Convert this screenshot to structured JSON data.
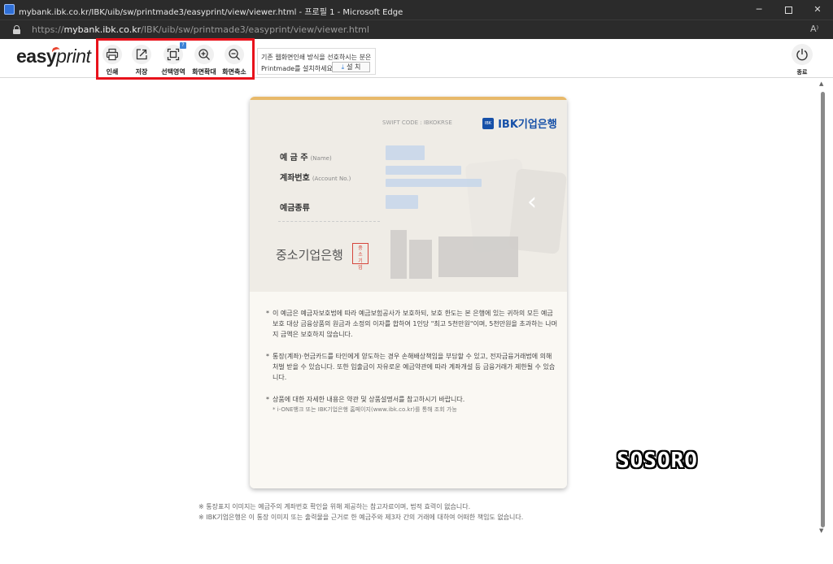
{
  "window": {
    "title": "mybank.ibk.co.kr/IBK/uib/sw/printmade3/easyprint/view/viewer.html - 프로필 1 - Microsoft Edge",
    "minimize": "─",
    "close": "✕"
  },
  "address": {
    "scheme": "https://",
    "host": "mybank.ibk.co.kr",
    "path": "/IBK/uib/sw/printmade3/easyprint/view/viewer.html",
    "read_aloud": "A⁾"
  },
  "toolbar": {
    "logo_easy": "easy",
    "logo_print": "print",
    "tools": {
      "print": "인쇄",
      "save": "저장",
      "select_area": "선택영역",
      "zoom_in": "화면확대",
      "zoom_out": "화면축소"
    },
    "promo_line1": "기존 웹화면인쇄 방식을 선호하시는 분은",
    "promo_line2": "Printmade를 설치하세요",
    "install_label": "설 치",
    "exit_label": "종료",
    "highlight_color": "#e8121b"
  },
  "card": {
    "swift_code": "SWIFT CODE : IBKOKRSE",
    "bank_logo": "IBK기업은행",
    "bank_logo_mark": "IBK",
    "fields": {
      "holder_ko": "예 금 주",
      "holder_en": "(Name)",
      "account_ko": "계좌번호",
      "account_en": "(Account No.)",
      "type_ko": "예금종류"
    },
    "bank_name": "중소기업은행",
    "seal_text": "중소기업은행",
    "notes": [
      "이 예금은 예금자보호법에 따라 예금보험공사가 보호하되, 보호 한도는 본 은행에 있는 귀하의 모든 예금보호 대상 금융상품의 원금과 소정의 이자를 합하여 1인당 \"최고 5천만원\"이며, 5천만원을 초과하는 나머지 금액은 보호하지 않습니다.",
      "통장(계좌)·현금카드를 타인에게 양도하는 경우 손해배상책임을 부담할 수 있고, 전자금융거래법에 의해 처벌 받을 수 있습니다. 또한 입출금이 자유로운 예금약관에 따라 계좌개설 등 금융거래가 제한될 수 있습니다.",
      "상품에 대한 자세한 내용은 약관 및 상품설명서를 참고하시기 바랍니다."
    ],
    "note_marker": "*",
    "subnote": "* i-ONE뱅크 또는 IBK기업은행 홈페이지(www.ibk.co.kr)를 통해 조회 가능"
  },
  "footer": {
    "line1": "※ 통장표지 이미지는 예금주의 계좌번호 확인을 위해 제공하는 참고자료이며, 법적 효력이 없습니다.",
    "line2": "※ IBK기업은행은 이 통장 이미지 또는 출력물을 근거로 한 예금주와 제3자 간의 거래에 대하여 어떠한 책임도 없습니다."
  },
  "watermark": "SOSORO",
  "scrollbar": {
    "up": "▲",
    "down": "▼"
  }
}
